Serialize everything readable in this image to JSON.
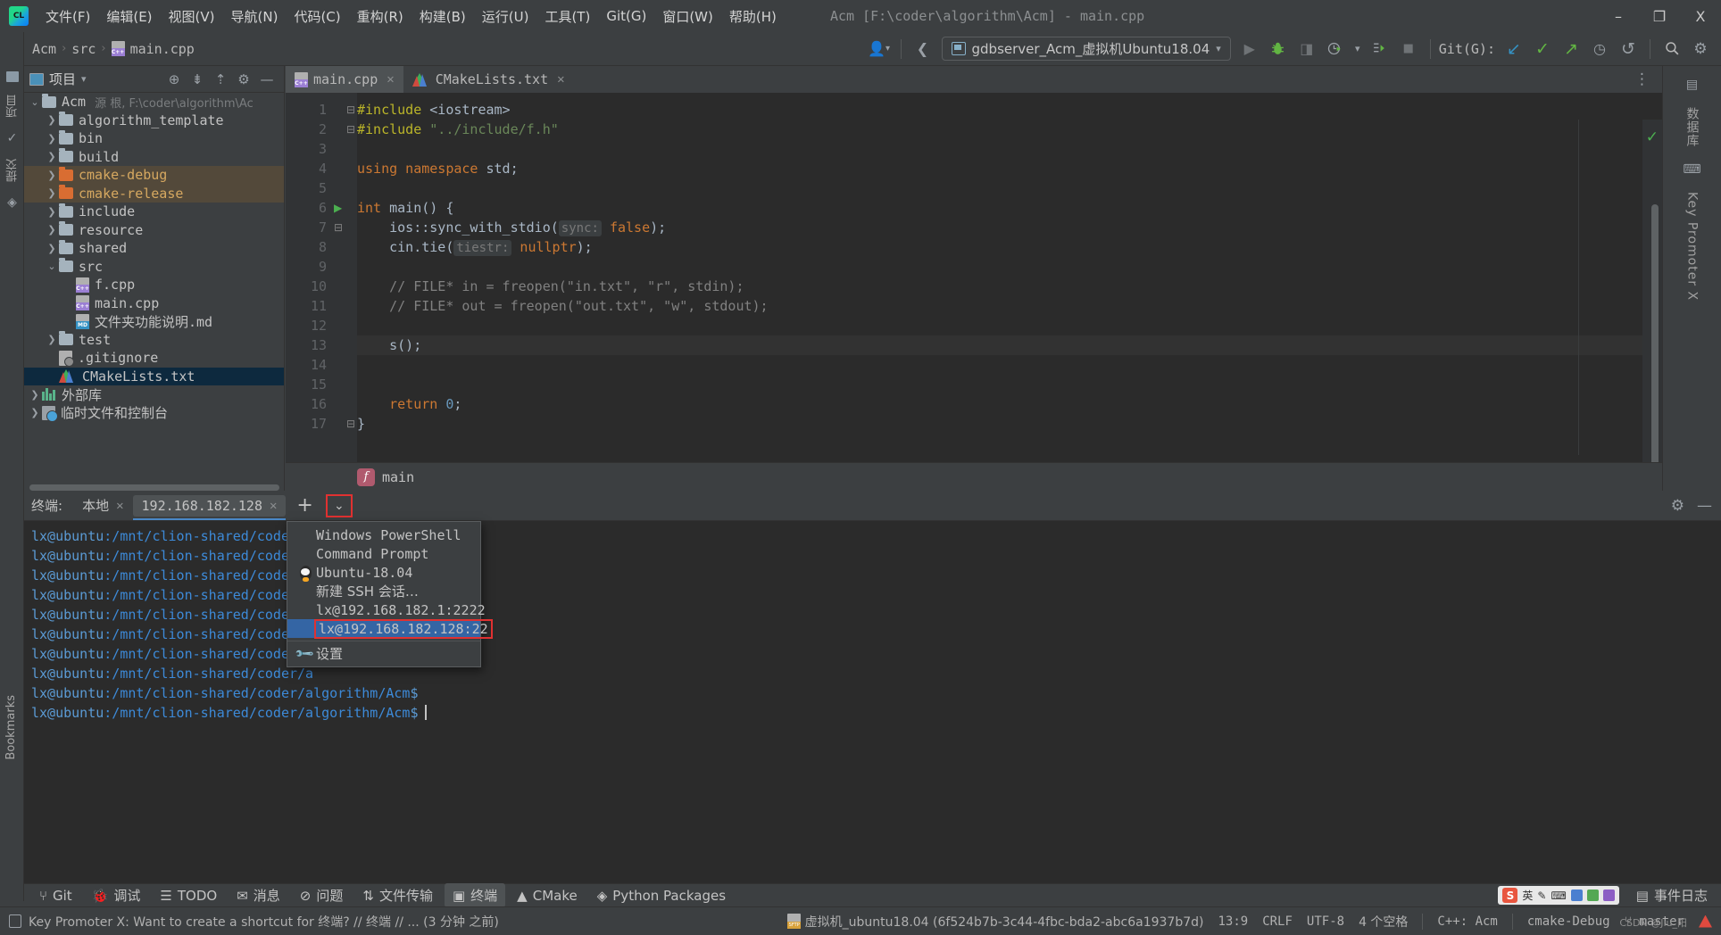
{
  "window": {
    "title": "Acm [F:\\coder\\algorithm\\Acm] - main.cpp",
    "minimize": "–",
    "maximize": "❐",
    "close": "X"
  },
  "menubar": {
    "logo": "CL",
    "items": [
      {
        "label": "文件(F)"
      },
      {
        "label": "编辑(E)"
      },
      {
        "label": "视图(V)"
      },
      {
        "label": "导航(N)"
      },
      {
        "label": "代码(C)"
      },
      {
        "label": "重构(R)"
      },
      {
        "label": "构建(B)"
      },
      {
        "label": "运行(U)"
      },
      {
        "label": "工具(T)"
      },
      {
        "label": "Git(G)"
      },
      {
        "label": "窗口(W)"
      },
      {
        "label": "帮助(H)"
      }
    ]
  },
  "toolbar": {
    "breadcrumb": [
      "Acm",
      "src",
      "main.cpp"
    ],
    "sep": "›",
    "run_config": "gdbserver_Acm_虚拟机Ubuntu18.04",
    "run_config_caret": "▾",
    "git_label": "Git(G):",
    "avatar_caret": "▾",
    "back_arrow": "❮",
    "icons": {
      "run": "▶",
      "debug": "🐞",
      "coverage": "◨",
      "profile": "◔",
      "profile_caret": "▾",
      "attach": "⇥",
      "stop": "■",
      "update": "↙",
      "commit": "✓",
      "push": "↗",
      "history": "◷",
      "rollback": "↺",
      "search": "🔍",
      "settings": "⚙"
    }
  },
  "project_panel": {
    "title": "项目",
    "title_caret": "▾",
    "header_icons": {
      "locate": "⊕",
      "expand_all": "⇟",
      "collapse_all": "⇡",
      "settings": "⚙",
      "hide": "—"
    },
    "tree": [
      {
        "label": "Acm",
        "sub": "源 根, F:\\coder\\algorithm\\Ac",
        "icon": "folder",
        "arrow": "⌄",
        "indent": 0,
        "state": "normal"
      },
      {
        "label": "algorithm_template",
        "icon": "folder",
        "arrow": "❯",
        "indent": 1,
        "state": "normal"
      },
      {
        "label": "bin",
        "icon": "folder",
        "arrow": "❯",
        "indent": 1,
        "state": "normal"
      },
      {
        "label": "build",
        "icon": "folder",
        "arrow": "❯",
        "indent": 1,
        "state": "normal"
      },
      {
        "label": "cmake-debug",
        "icon": "folder-orange",
        "arrow": "❯",
        "indent": 1,
        "state": "excluded"
      },
      {
        "label": "cmake-release",
        "icon": "folder-orange",
        "arrow": "❯",
        "indent": 1,
        "state": "excluded"
      },
      {
        "label": "include",
        "icon": "folder",
        "arrow": "❯",
        "indent": 1,
        "state": "normal"
      },
      {
        "label": "resource",
        "icon": "folder",
        "arrow": "❯",
        "indent": 1,
        "state": "normal"
      },
      {
        "label": "shared",
        "icon": "folder",
        "arrow": "❯",
        "indent": 1,
        "state": "normal"
      },
      {
        "label": "src",
        "icon": "folder",
        "arrow": "⌄",
        "indent": 1,
        "state": "normal"
      },
      {
        "label": "f.cpp",
        "icon": "cpp",
        "arrow": "",
        "indent": 2,
        "state": "normal"
      },
      {
        "label": "main.cpp",
        "icon": "cpp",
        "arrow": "",
        "indent": 2,
        "state": "normal"
      },
      {
        "label": "文件夹功能说明.md",
        "icon": "md",
        "arrow": "",
        "indent": 2,
        "state": "normal"
      },
      {
        "label": "test",
        "icon": "folder",
        "arrow": "❯",
        "indent": 1,
        "state": "normal"
      },
      {
        "label": ".gitignore",
        "icon": "git",
        "arrow": "",
        "indent": 1,
        "state": "normal"
      },
      {
        "label": "CMakeLists.txt",
        "icon": "cmake",
        "arrow": "",
        "indent": 1,
        "state": "selected"
      },
      {
        "label": "外部库",
        "icon": "lib",
        "arrow": "❯",
        "indent": 0,
        "state": "normal"
      },
      {
        "label": "临时文件和控制台",
        "icon": "scratch",
        "arrow": "❯",
        "indent": 0,
        "state": "normal"
      }
    ]
  },
  "editor": {
    "tabs": [
      {
        "label": "main.cpp",
        "icon": "cpp",
        "active": true,
        "close": "✕"
      },
      {
        "label": "CMakeLists.txt",
        "icon": "cmake",
        "active": false,
        "close": "✕"
      }
    ],
    "more_icon": "⋮",
    "inspection_status": "✓",
    "current_line": 13,
    "line_numbers": [
      1,
      2,
      3,
      4,
      5,
      6,
      7,
      8,
      9,
      10,
      11,
      12,
      13,
      14,
      15,
      16,
      17
    ],
    "lines": [
      {
        "n": 1,
        "fold": "⊟",
        "run": "",
        "tokens": [
          {
            "t": "#include ",
            "c": "pre"
          },
          {
            "t": "<iostream>",
            "c": "txt"
          }
        ]
      },
      {
        "n": 2,
        "fold": "⊟",
        "run": "",
        "tokens": [
          {
            "t": "#include ",
            "c": "pre"
          },
          {
            "t": "\"../include/f.h\"",
            "c": "str"
          }
        ]
      },
      {
        "n": 3,
        "fold": "",
        "run": "",
        "tokens": []
      },
      {
        "n": 4,
        "fold": "",
        "run": "",
        "tokens": [
          {
            "t": "using namespace ",
            "c": "kw"
          },
          {
            "t": "std;",
            "c": "txt"
          }
        ]
      },
      {
        "n": 5,
        "fold": "",
        "run": "",
        "tokens": []
      },
      {
        "n": 6,
        "fold": "⊟",
        "run": "▶",
        "tokens": [
          {
            "t": "int",
            "c": "kw"
          },
          {
            "t": " main() {",
            "c": "txt"
          }
        ]
      },
      {
        "n": 7,
        "fold": "",
        "run": "",
        "tokens": [
          {
            "t": "    ios::sync_with_stdio(",
            "c": "txt"
          },
          {
            "t": "sync:",
            "c": "hint"
          },
          {
            "t": " ",
            "c": "txt"
          },
          {
            "t": "false",
            "c": "kw"
          },
          {
            "t": ");",
            "c": "txt"
          }
        ]
      },
      {
        "n": 8,
        "fold": "",
        "run": "",
        "tokens": [
          {
            "t": "    cin.tie(",
            "c": "txt"
          },
          {
            "t": "tiestr:",
            "c": "hint"
          },
          {
            "t": " ",
            "c": "txt"
          },
          {
            "t": "nullptr",
            "c": "kw"
          },
          {
            "t": ");",
            "c": "txt"
          }
        ]
      },
      {
        "n": 9,
        "fold": "",
        "run": "",
        "tokens": []
      },
      {
        "n": 10,
        "fold": "",
        "run": "",
        "tokens": [
          {
            "t": "    // FILE* in = freopen(\"in.txt\", \"r\", stdin);",
            "c": "cmt"
          }
        ]
      },
      {
        "n": 11,
        "fold": "",
        "run": "",
        "tokens": [
          {
            "t": "    // FILE* out = freopen(\"out.txt\", \"w\", stdout);",
            "c": "cmt"
          }
        ]
      },
      {
        "n": 12,
        "fold": "",
        "run": "",
        "tokens": []
      },
      {
        "n": 13,
        "fold": "",
        "run": "",
        "tokens": [
          {
            "t": "    s();",
            "c": "txt"
          }
        ]
      },
      {
        "n": 14,
        "fold": "",
        "run": "",
        "tokens": []
      },
      {
        "n": 15,
        "fold": "",
        "run": "",
        "tokens": []
      },
      {
        "n": 16,
        "fold": "",
        "run": "",
        "tokens": [
          {
            "t": "    ",
            "c": "txt"
          },
          {
            "t": "return",
            "c": "kw"
          },
          {
            "t": " ",
            "c": "txt"
          },
          {
            "t": "0",
            "c": "num"
          },
          {
            "t": ";",
            "c": "txt"
          }
        ]
      },
      {
        "n": 17,
        "fold": "⊟",
        "run": "",
        "tokens": [
          {
            "t": "}",
            "c": "txt"
          }
        ]
      }
    ],
    "footer_function": "main",
    "footer_badge": "f"
  },
  "right_strip": {
    "items": [
      "数据库",
      "Key Promoter X"
    ]
  },
  "left_strip": {
    "items": [
      "项目",
      "提交",
      "Bookmarks"
    ]
  },
  "terminal": {
    "label": "终端:",
    "tabs": [
      {
        "label": "本地",
        "active": false,
        "close": "✕"
      },
      {
        "label": "192.168.182.128",
        "active": true,
        "close": "✕"
      }
    ],
    "add": "+",
    "chevron": "⌄",
    "settings_icon": "⚙",
    "hide_icon": "—",
    "lines": [
      {
        "user": "lx@ubuntu",
        "path": ":/mnt/clion-shared/coder/a",
        "tail": ""
      },
      {
        "user": "lx@ubuntu",
        "path": ":/mnt/clion-shared/coder/a",
        "tail": ""
      },
      {
        "user": "lx@ubuntu",
        "path": ":/mnt/clion-shared/coder/a",
        "tail": ""
      },
      {
        "user": "lx@ubuntu",
        "path": ":/mnt/clion-shared/coder/a",
        "tail": ""
      },
      {
        "user": "lx@ubuntu",
        "path": ":/mnt/clion-shared/coder/a",
        "tail": ""
      },
      {
        "user": "lx@ubuntu",
        "path": ":/mnt/clion-shared/coder/a",
        "tail": ""
      },
      {
        "user": "lx@ubuntu",
        "path": ":/mnt/clion-shared/coder/a",
        "tail": ""
      },
      {
        "user": "lx@ubuntu",
        "path": ":/mnt/clion-shared/coder/a",
        "tail": ""
      },
      {
        "user": "lx@ubuntu",
        "path": ":/mnt/clion-shared/coder/algorithm/Acm",
        "tail": "$"
      },
      {
        "user": "lx@ubuntu",
        "path": ":/mnt/clion-shared/coder/algorithm/Acm",
        "tail": "$",
        "caret": true
      }
    ]
  },
  "dropdown": {
    "items": [
      {
        "label": "Windows PowerShell",
        "icon": "",
        "selected": false
      },
      {
        "label": "Command Prompt",
        "icon": "",
        "selected": false
      },
      {
        "label": "Ubuntu-18.04",
        "icon": "tux",
        "selected": false
      },
      {
        "label": "新建 SSH 会话…",
        "icon": "",
        "selected": false,
        "zh": true
      },
      {
        "label": "lx@192.168.182.1:2222",
        "icon": "",
        "selected": false
      },
      {
        "label": "lx@192.168.182.128:22",
        "icon": "",
        "selected": true
      },
      {
        "label": "设置",
        "icon": "wrench",
        "selected": false,
        "zh": true
      }
    ]
  },
  "toolwindow_bar": {
    "items": [
      {
        "label": "Git",
        "icon": "⑂",
        "active": false
      },
      {
        "label": "调试",
        "icon": "🐞",
        "active": false
      },
      {
        "label": "TODO",
        "icon": "☰",
        "active": false
      },
      {
        "label": "消息",
        "icon": "✉",
        "active": false
      },
      {
        "label": "问题",
        "icon": "⊘",
        "active": false
      },
      {
        "label": "文件传输",
        "icon": "⇅",
        "active": false
      },
      {
        "label": "终端",
        "icon": "▣",
        "active": true
      },
      {
        "label": "CMake",
        "icon": "▲",
        "active": false
      },
      {
        "label": "Python Packages",
        "icon": "◈",
        "active": false
      }
    ],
    "ime": {
      "logo": "S",
      "mode": "英",
      "icons": [
        "✎",
        "⌨",
        "🗂",
        "🏆",
        "⊞"
      ]
    },
    "event_log": {
      "icon": "▤",
      "label": "事件日志"
    }
  },
  "statusbar": {
    "key_promoter": "Key Promoter X: Want to create a shortcut for 终端? // 终端 // ... (3 分钟 之前)",
    "deployment": "虚拟机_ubuntu18.04 (6f524b7b-3c44-4fbc-bda2-abc6a1937b7d)",
    "caret_position": "13:9",
    "line_separator": "CRLF",
    "encoding": "UTF-8",
    "indent": "4 个空格",
    "language_scope": "C++: Acm",
    "build_profile": "cmake-Debug",
    "branch": "master",
    "branch_icon": "⑂",
    "error_icon": "!",
    "watermark": "CSDN @Jiu_阳"
  },
  "colors": {
    "accent_blue": "#3465a4",
    "highlight_red": "#e03131",
    "excluded_orange": "#d6a860",
    "selection_navy": "#0d293e",
    "terminal_blue": "#3d8ad8",
    "keyword_orange": "#cc7832",
    "string_green": "#6a8759",
    "preproc_yellow": "#bbb529"
  }
}
